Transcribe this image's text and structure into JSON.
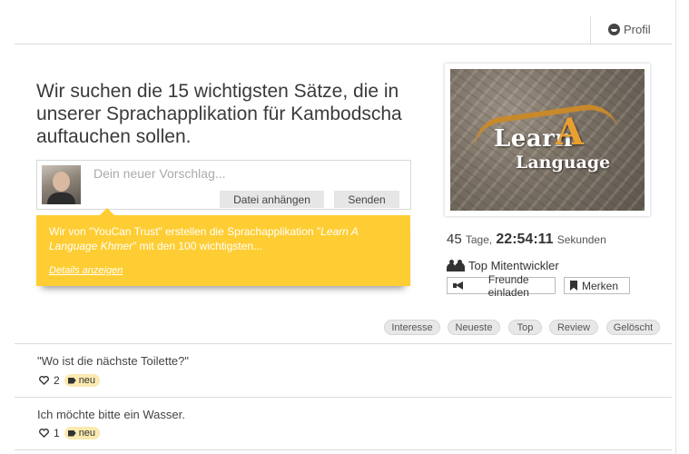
{
  "header": {
    "profile_label": "Profil"
  },
  "challenge": {
    "headline": "Wir suchen die 15 wichtigsten Sätze, die in unserer Sprachapplikation für Kambodscha auftauchen sollen."
  },
  "composer": {
    "placeholder": "Dein neuer Vorschlag...",
    "attach_label": "Datei anhängen",
    "send_label": "Senden"
  },
  "info": {
    "text_prefix": "Wir von \"YouCan Trust\" erstellen die Sprachapplikation \"",
    "text_italic": "Learn A Language Khmer",
    "text_suffix": "\" mit den 100 wichtigsten...",
    "details_label": "Details anzeigen"
  },
  "hero": {
    "logo_learn": "Learn",
    "logo_a": "A",
    "logo_language": "Language"
  },
  "countdown": {
    "days": "45",
    "days_label": "Tage,",
    "time": "22:54:11",
    "seconds_label": "Sekunden"
  },
  "sidebar": {
    "top_dev_label": "Top Mitentwickler",
    "invite_label": "Freunde einladen",
    "bookmark_label": "Merken"
  },
  "filters": [
    "Interesse",
    "Neueste",
    "Top",
    "Review",
    "Gelöscht"
  ],
  "suggestions": [
    {
      "text": "\"Wo ist die nächste Toilette?\"",
      "likes": "2",
      "tag": "neu"
    },
    {
      "text": "Ich möchte bitte ein Wasser.",
      "likes": "1",
      "tag": "neu"
    }
  ],
  "colors": {
    "info_bg": "#fecd33",
    "tag_bg": "#fbe9b0",
    "logo_accent": "#e8a030"
  }
}
